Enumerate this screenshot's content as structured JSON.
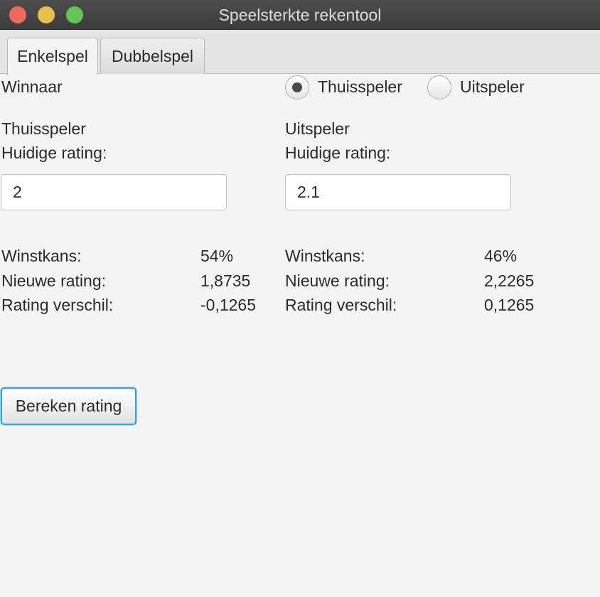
{
  "window": {
    "title": "Speelsterkte rekentool"
  },
  "tabs": [
    {
      "label": "Enkelspel",
      "active": true
    },
    {
      "label": "Dubbelspel",
      "active": false
    }
  ],
  "winner": {
    "label": "Winnaar",
    "options": [
      {
        "label": "Thuisspeler",
        "selected": true
      },
      {
        "label": "Uitspeler",
        "selected": false
      }
    ]
  },
  "home": {
    "heading": "Thuisspeler",
    "rating_label": "Huidige rating:",
    "rating_value": "2",
    "win_chance_label": "Winstkans:",
    "win_chance": "54%",
    "new_rating_label": "Nieuwe rating:",
    "new_rating": "1,8735",
    "diff_label": "Rating verschil:",
    "diff": "-0,1265"
  },
  "away": {
    "heading": "Uitspeler",
    "rating_label": "Huidige rating:",
    "rating_value": "2.1",
    "win_chance_label": "Winstkans:",
    "win_chance": "46%",
    "new_rating_label": "Nieuwe rating:",
    "new_rating": "2,2265",
    "diff_label": "Rating verschil:",
    "diff": "0,1265"
  },
  "actions": {
    "calculate_label": "Bereken rating"
  },
  "colors": {
    "accent": "#3aa0dd",
    "background": "#f4f4f4",
    "titlebar": "#444444"
  }
}
